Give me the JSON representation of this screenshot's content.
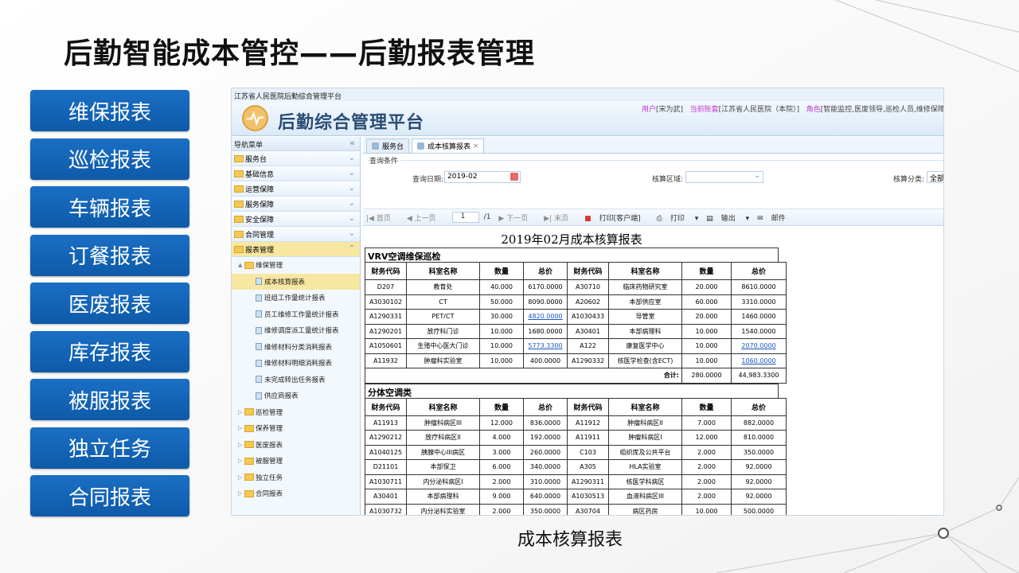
{
  "slide": {
    "title": "后勤智能成本管控——后勤报表管理",
    "caption": "成本核算报表",
    "side_buttons": [
      "维保报表",
      "巡检报表",
      "车辆报表",
      "订餐报表",
      "医废报表",
      "库存报表",
      "被服报表",
      "独立任务",
      "合同报表"
    ]
  },
  "app": {
    "window_title": "江苏省人民医院后勤综合管理平台",
    "name": "后勤综合管理平台",
    "user_label": "用户",
    "user_value": "[宋为武]",
    "account_label": "当前账套",
    "account_value": "[江苏省人民医院（本院）]",
    "role_label": "角色",
    "role_value": "[智能监控,医废领导,巡检人员,维修保障科"
  },
  "nav": {
    "title": "导航菜单",
    "collapse_icon": "«",
    "groups": [
      "服务台",
      "基础信息",
      "运营保障",
      "服务保障",
      "安全保障",
      "合同管理",
      "报表管理"
    ],
    "tree": [
      {
        "label": "维保管理",
        "level": 0,
        "type": "folder",
        "arrow": "▲"
      },
      {
        "label": "成本核算报表",
        "level": 1,
        "type": "file",
        "selected": true
      },
      {
        "label": "班组工作量统计报表",
        "level": 1,
        "type": "file"
      },
      {
        "label": "员工维修工作量统计报表",
        "level": 1,
        "type": "file"
      },
      {
        "label": "维修调度派工量统计报表",
        "level": 1,
        "type": "file"
      },
      {
        "label": "维修材料分类消耗报表",
        "level": 1,
        "type": "file"
      },
      {
        "label": "维修材料明细消耗报表",
        "level": 1,
        "type": "file"
      },
      {
        "label": "未完成转出任务报表",
        "level": 1,
        "type": "file"
      },
      {
        "label": "供应商报表",
        "level": 1,
        "type": "file"
      },
      {
        "label": "巡检管理",
        "level": 0,
        "type": "folder",
        "arrow": "▷"
      },
      {
        "label": "保养管理",
        "level": 0,
        "type": "folder",
        "arrow": "▷"
      },
      {
        "label": "医废报表",
        "level": 0,
        "type": "folder",
        "arrow": "▷"
      },
      {
        "label": "被服管理",
        "level": 0,
        "type": "folder",
        "arrow": "▷"
      },
      {
        "label": "独立任务",
        "level": 0,
        "type": "folder",
        "arrow": "▷"
      },
      {
        "label": "合同报表",
        "level": 0,
        "type": "folder",
        "arrow": "▷"
      }
    ]
  },
  "tabs": [
    {
      "label": "服务台",
      "close": ""
    },
    {
      "label": "成本核算报表",
      "close": "×"
    }
  ],
  "query": {
    "legend": "查询条件",
    "date_label": "查询日期:",
    "date_value": "2019-02",
    "area_label": "核算区域:",
    "area_value": "",
    "category_label": "核算分类:",
    "category_value": "全部"
  },
  "toolbar": {
    "first": "首页",
    "prev": "上一页",
    "page": "1",
    "of": "/1",
    "next": "下一页",
    "last": "末页",
    "print_client": "打印[客户端]",
    "print": "打印",
    "export": "输出",
    "mail": "邮件"
  },
  "report": {
    "title": "2019年02月成本核算报表",
    "headers": [
      "财务代码",
      "科室名称",
      "数量",
      "总价",
      "财务代码",
      "科室名称",
      "数量",
      "总价"
    ],
    "sections": [
      {
        "title": "VRV空调维保巡检",
        "rows": [
          [
            "D207",
            "教育处",
            "40.000",
            "6170.0000",
            "A30710",
            "临床药物研究室",
            "20.000",
            "8610.0000"
          ],
          [
            "A3030102",
            "CT",
            "50.000",
            "8090.0000",
            "A20602",
            "本部供应室",
            "60.000",
            "3310.0000"
          ],
          [
            "A1290331",
            "PET/CT",
            "30.000",
            "4820.0000",
            "A1030433",
            "导管室",
            "20.000",
            "1460.0000"
          ],
          [
            "A1290201",
            "放疗科门诊",
            "10.000",
            "1680.0000",
            "A30401",
            "本部病理科",
            "10.000",
            "1540.0000"
          ],
          [
            "A1050601",
            "生殖中心医大门诊",
            "10.000",
            "5773.3300",
            "A122",
            "康复医学中心",
            "10.000",
            "2070.0000"
          ],
          [
            "A11932",
            "肿瘤科实验室",
            "10.000",
            "400.0000",
            "A1290332",
            "核医学检查(含ECT)",
            "10.000",
            "1060.0000"
          ]
        ],
        "links": [
          [
            2,
            3
          ],
          [
            4,
            3
          ],
          [
            4,
            7
          ],
          [
            5,
            7
          ]
        ],
        "total_label": "合计:",
        "total_qty": "280.0000",
        "total_price": "44,983.3300"
      },
      {
        "title": "分体空调类",
        "rows": [
          [
            "A11913",
            "肿瘤科病区III",
            "12.000",
            "836.0000",
            "A11912",
            "肿瘤科病区II",
            "7.000",
            "882.0000"
          ],
          [
            "A1290212",
            "放疗科病区II",
            "4.000",
            "192.0000",
            "A11911",
            "肿瘤科病区I",
            "12.000",
            "810.0000"
          ],
          [
            "A1040125",
            "胰腺中心III病区",
            "3.000",
            "260.0000",
            "C103",
            "组织库及公共平台",
            "2.000",
            "350.0000"
          ],
          [
            "D21101",
            "本部保卫",
            "6.000",
            "340.0000",
            "A305",
            "HLA实验室",
            "2.000",
            "92.0000"
          ],
          [
            "A1030711",
            "内分泌科病区I",
            "2.000",
            "310.0000",
            "A1290311",
            "核医学科病区",
            "2.000",
            "92.0000"
          ],
          [
            "A30401",
            "本部病理科",
            "9.000",
            "640.0000",
            "A1030513",
            "血液科病区III",
            "2.000",
            "92.0000"
          ],
          [
            "A1030732",
            "内分泌科实验室",
            "2.000",
            "350.0000",
            "A30704",
            "病区药房",
            "10.000",
            "500.0000"
          ]
        ],
        "links": []
      }
    ]
  }
}
